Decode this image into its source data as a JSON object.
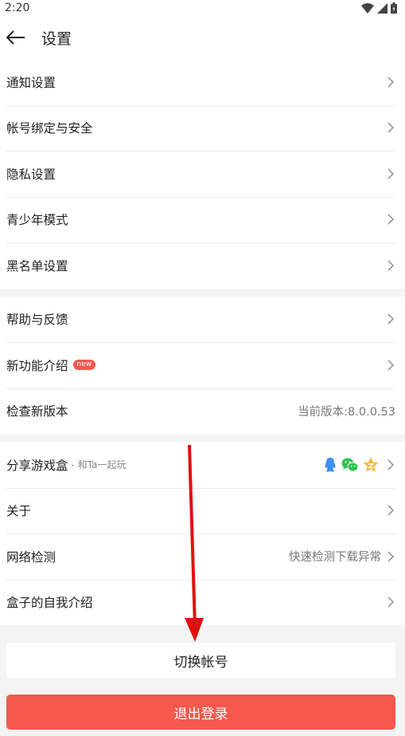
{
  "status_bar": {
    "time": "2:20"
  },
  "header": {
    "title": "设置"
  },
  "groups": [
    {
      "items": [
        {
          "label": "通知设置"
        },
        {
          "label": "帐号绑定与安全"
        },
        {
          "label": "隐私设置"
        },
        {
          "label": "青少年模式"
        },
        {
          "label": "黑名单设置"
        }
      ]
    },
    {
      "items": [
        {
          "label": "帮助与反馈"
        },
        {
          "label": "新功能介绍",
          "badge": "new"
        },
        {
          "label": "检查新版本",
          "value": "当前版本:8.0.0.53"
        }
      ]
    },
    {
      "items": [
        {
          "label": "分享游戏盒",
          "sub": "- 和Ta一起玩",
          "icons": [
            "qq-icon",
            "wechat-icon",
            "qzone-icon"
          ]
        },
        {
          "label": "关于"
        },
        {
          "label": "网络检测",
          "value": "快速检测下载异常"
        },
        {
          "label": "盒子的自我介绍"
        }
      ]
    }
  ],
  "buttons": {
    "switch_account": "切换帐号",
    "logout": "退出登录"
  },
  "colors": {
    "accent": "#f5584d",
    "annotation_arrow": "#e01010"
  }
}
